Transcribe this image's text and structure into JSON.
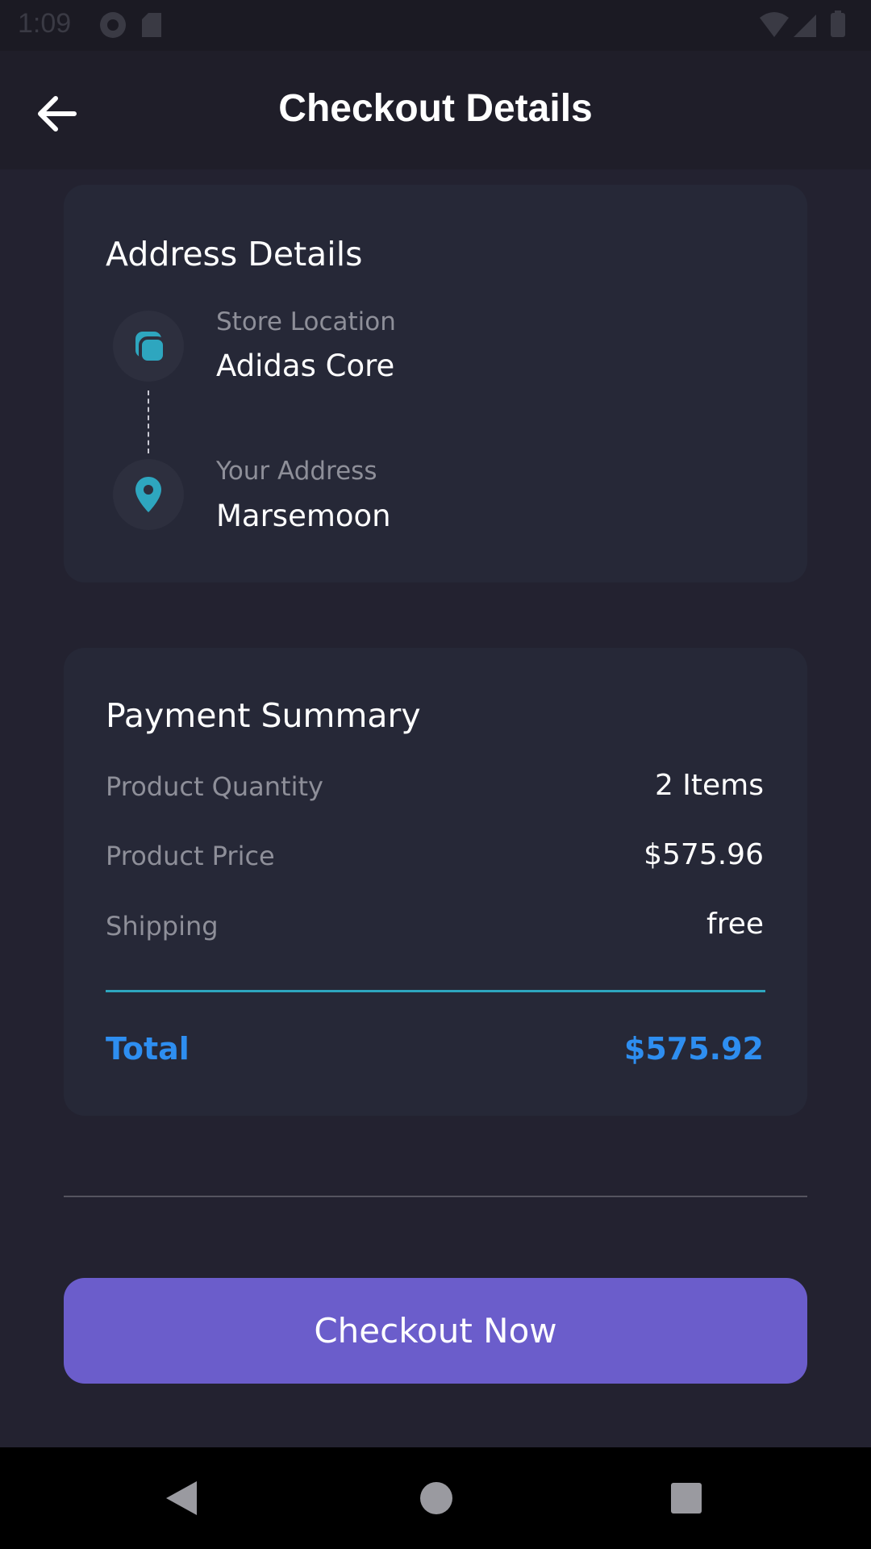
{
  "status_bar": {
    "time": "1:09",
    "icons_left": [
      "data-saver-icon",
      "sd-card-icon"
    ],
    "icons_right": [
      "wifi-icon",
      "signal-icon",
      "battery-icon"
    ]
  },
  "app_bar": {
    "title": "Checkout Details",
    "back_icon": "arrow-left-icon"
  },
  "address": {
    "title": "Address Details",
    "store_label": "Store Location",
    "store_value": "Adidas Core",
    "store_icon": "store-icon",
    "address_label": "Your Address",
    "address_value": "Marsemoon",
    "address_icon": "location-pin-icon"
  },
  "payment": {
    "title": "Payment Summary",
    "rows": [
      {
        "label": "Product Quantity",
        "value": "2 Items"
      },
      {
        "label": "Product Price",
        "value": "$575.96"
      },
      {
        "label": "Shipping",
        "value": "free"
      }
    ],
    "total_label": "Total",
    "total_value": "$575.92"
  },
  "checkout_button": "Checkout Now",
  "colors": {
    "background": "#232230",
    "card": "#262837",
    "accent_teal": "#2ea6bf",
    "total_blue": "#2e8ef0",
    "button_purple": "#6b5dcb"
  },
  "nav": [
    "back-triangle-icon",
    "home-circle-icon",
    "recents-square-icon"
  ]
}
